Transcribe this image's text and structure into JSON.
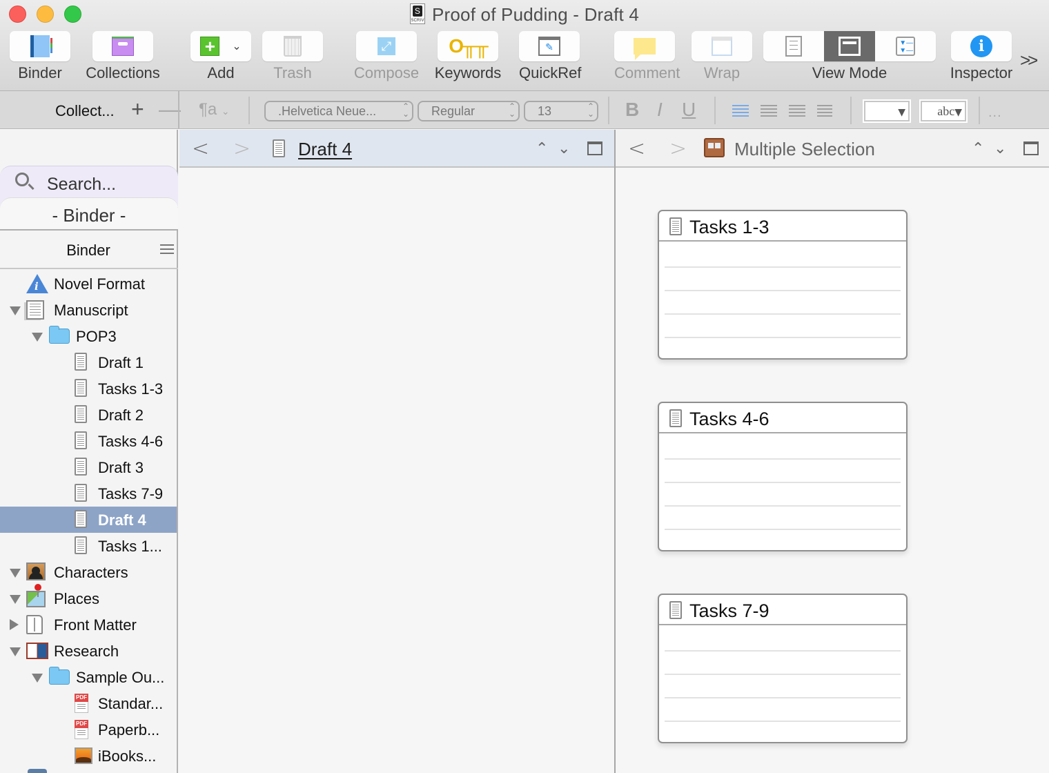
{
  "window": {
    "title": "Proof of Pudding - Draft 4",
    "file_badge": "SCRIV"
  },
  "toolbar": {
    "items": [
      {
        "label": "Binder",
        "enabled": true
      },
      {
        "label": "Collections",
        "enabled": true
      },
      {
        "label": "Add",
        "enabled": true
      },
      {
        "label": "Trash",
        "enabled": false
      },
      {
        "label": "Compose",
        "enabled": false
      },
      {
        "label": "Keywords",
        "enabled": true
      },
      {
        "label": "QuickRef",
        "enabled": true
      },
      {
        "label": "Comment",
        "enabled": false
      },
      {
        "label": "Wrap",
        "enabled": false
      },
      {
        "label": "View Mode",
        "enabled": true,
        "segments": [
          "document",
          "corkboard",
          "outliner"
        ],
        "active_segment": "corkboard"
      },
      {
        "label": "Inspector",
        "enabled": true
      }
    ],
    "overflow": ">>"
  },
  "formatbar": {
    "collections_label": "Collect...",
    "add_symbol": "+",
    "remove_symbol": "—",
    "paragraph_style": "¶a",
    "font_family": ".Helvetica Neue...",
    "font_style": "Regular",
    "font_size": "13",
    "bold": "B",
    "italic": "I",
    "underline": "U",
    "alignment_active": "left",
    "highlight_label": "abc",
    "more": "..."
  },
  "sidebar": {
    "search_label": "Search...",
    "binder_tab_label": "- Binder -",
    "binder_header": "Binder",
    "items": [
      {
        "label": "Novel Format",
        "icon": "info-icon",
        "level": 0,
        "disclosure": "none"
      },
      {
        "label": "Manuscript",
        "icon": "manuscript-icon",
        "level": 0,
        "disclosure": "open"
      },
      {
        "label": "POP3",
        "icon": "folder-icon",
        "level": 1,
        "disclosure": "open"
      },
      {
        "label": "Draft 1",
        "icon": "text-document-icon",
        "level": 2,
        "disclosure": "none"
      },
      {
        "label": "Tasks 1-3",
        "icon": "text-document-icon",
        "level": 2,
        "disclosure": "none"
      },
      {
        "label": "Draft 2",
        "icon": "text-document-icon",
        "level": 2,
        "disclosure": "none"
      },
      {
        "label": "Tasks 4-6",
        "icon": "text-document-icon",
        "level": 2,
        "disclosure": "none"
      },
      {
        "label": "Draft 3",
        "icon": "text-document-icon",
        "level": 2,
        "disclosure": "none"
      },
      {
        "label": "Tasks 7-9",
        "icon": "text-document-icon",
        "level": 2,
        "disclosure": "none"
      },
      {
        "label": "Draft 4",
        "icon": "text-document-icon",
        "level": 2,
        "disclosure": "none",
        "selected": true
      },
      {
        "label": "Tasks 1...",
        "icon": "text-document-icon",
        "level": 2,
        "disclosure": "none"
      },
      {
        "label": "Characters",
        "icon": "characters-icon",
        "level": 0,
        "disclosure": "open"
      },
      {
        "label": "Places",
        "icon": "places-icon",
        "level": 0,
        "disclosure": "open"
      },
      {
        "label": "Front Matter",
        "icon": "front-matter-icon",
        "level": 0,
        "disclosure": "closed"
      },
      {
        "label": "Research",
        "icon": "research-icon",
        "level": 0,
        "disclosure": "open"
      },
      {
        "label": "Sample Ou...",
        "icon": "folder-icon",
        "level": 1,
        "disclosure": "open"
      },
      {
        "label": "Standar...",
        "icon": "pdf-icon",
        "level": 2,
        "disclosure": "none"
      },
      {
        "label": "Paperb...",
        "icon": "pdf-icon",
        "level": 2,
        "disclosure": "none"
      },
      {
        "label": "iBooks...",
        "icon": "image-icon",
        "level": 2,
        "disclosure": "none"
      }
    ]
  },
  "left_editor": {
    "header_title": "Draft 4",
    "back": "<",
    "forward": ">"
  },
  "right_editor": {
    "header_title": "Multiple Selection",
    "back": "<",
    "forward": ">",
    "cards": [
      {
        "title": "Tasks 1-3"
      },
      {
        "title": "Tasks 4-6"
      },
      {
        "title": "Tasks 7-9"
      }
    ]
  },
  "colors": {
    "selection": "#8da4c7",
    "left_header_bg": "#dfe6ef",
    "accent_blue": "#2196f3"
  }
}
